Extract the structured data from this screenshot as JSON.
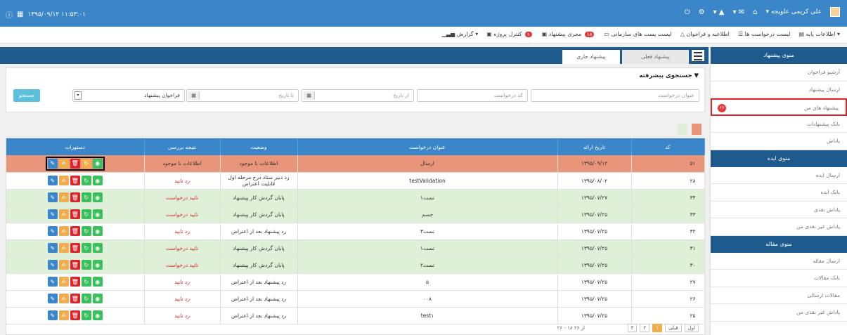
{
  "topbar": {
    "datetime": "۱۳۹۵/۰۹/۱۲ ۱۱:۵۳:۰۱",
    "user_name": "علی کریمی علویجه"
  },
  "menu": {
    "items": [
      "اطلاعات پایه",
      "لیست درخواست ها",
      "اطلاعیه و فراخوان",
      "لیست پست های سازمانی",
      "مجری پیشنهاد",
      "کنترل پروژه",
      "گزارش"
    ],
    "badge_mojri": "۱۸",
    "badge_control": "۱"
  },
  "sidebar": {
    "header1": "منوی پیشنهاد",
    "items1": [
      "آرشیو فراخوان",
      "ارسال پیشنهاد",
      "پیشنهاد های من",
      "بانک پیشنهادات",
      "پاداش"
    ],
    "badge": "۲۶",
    "header2": "منوی ایده",
    "items2": [
      "ارسال ایده",
      "بانک ایده",
      "پاداش نقدی",
      "پاداش غیر نقدی من"
    ],
    "header3": "منوی مقاله",
    "items3": [
      "ارسال مقاله",
      "بانک مقالات",
      "مقالات ارسالی",
      "پاداش غیر نقدی من"
    ]
  },
  "tabs": {
    "active": "پیشنهاد جاری",
    "inactive": "پیشنهاد فعلی"
  },
  "search": {
    "title": "جستجوی پیشرفته",
    "title_placeholder": "عنوان درخواست",
    "code_placeholder": "کد درخواست",
    "from_date": "از تاریخ",
    "to_date": "تا تاریخ",
    "select_value": "فراخوان پیشنهاد",
    "button": "جستجو"
  },
  "colors": {
    "primary": "#3a86c8",
    "dark": "#1e5a8c",
    "salmon": "#e8957a",
    "green_row": "#dff0d8",
    "legend_green": "#dff0d8",
    "legend_orange": "#e8957a"
  },
  "table": {
    "headers": [
      "کد",
      "تاریخ ارائه",
      "عنوان درخواست",
      "وضعیت",
      "نتیجه بررسی",
      "دستورات"
    ],
    "rows": [
      {
        "code": "۵۱",
        "date": "۱۳۹۵/۰۹/۱۲",
        "title": "ارسال",
        "status": "اطلاعات نا موجود",
        "result": "اطلاعات نا موجود",
        "tone": "salmon"
      },
      {
        "code": "۲۸",
        "date": "۱۳۹۵/۰۸/۰۲",
        "title": "testValidation",
        "status": "رد دبیر ستاد درج مرحله اول قابلیت اعتراض",
        "result": "رد تایید",
        "tone": "white"
      },
      {
        "code": "۳۴",
        "date": "۱۳۹۵/۰۷/۲۷",
        "title": "تست۱",
        "status": "پایان گردش کار پیشنهاد",
        "result": "تایید درخواست",
        "tone": "green"
      },
      {
        "code": "۳۳",
        "date": "۱۳۹۵/۰۷/۲۵",
        "title": "جسم",
        "status": "پایان گردش کار پیشنهاد",
        "result": "تایید درخواست",
        "tone": "green"
      },
      {
        "code": "۳۲",
        "date": "۱۳۹۵/۰۷/۲۵",
        "title": "تست۳",
        "status": "رد پیشنهاد بعد از اعتراض",
        "result": "رد تایید",
        "tone": "white"
      },
      {
        "code": "۳۱",
        "date": "۱۳۹۵/۰۷/۲۵",
        "title": "تست۱",
        "status": "پایان گردش کار پیشنهاد",
        "result": "تایید درخواست",
        "tone": "green"
      },
      {
        "code": "۳۰",
        "date": "۱۳۹۵/۰۷/۲۵",
        "title": "تست۲",
        "status": "پایان گردش کار پیشنهاد",
        "result": "تایید درخواست",
        "tone": "green"
      },
      {
        "code": "۲۷",
        "date": "۱۳۹۵/۰۷/۲۵",
        "title": "۵",
        "status": "رد پیشنهاد بعد از اعتراض",
        "result": "رد تایید",
        "tone": "white"
      },
      {
        "code": "۲۶",
        "date": "۱۳۹۵/۰۷/۲۵",
        "title": "۰۰۸",
        "status": "رد پیشنهاد بعد از اعتراض",
        "result": "رد تایید",
        "tone": "white"
      },
      {
        "code": "۲۵",
        "date": "۱۳۹۵/۰۷/۲۵",
        "title": "test۱",
        "status": "رد پیشنهاد بعد از اعتراض",
        "result": "رد تایید",
        "tone": "white"
      }
    ]
  },
  "pager": {
    "first": "اول",
    "prev": "قبلی",
    "pages": [
      "۱",
      "۲",
      "۳"
    ],
    "info": "۲۶ - ۱۸ از ۲۶"
  }
}
